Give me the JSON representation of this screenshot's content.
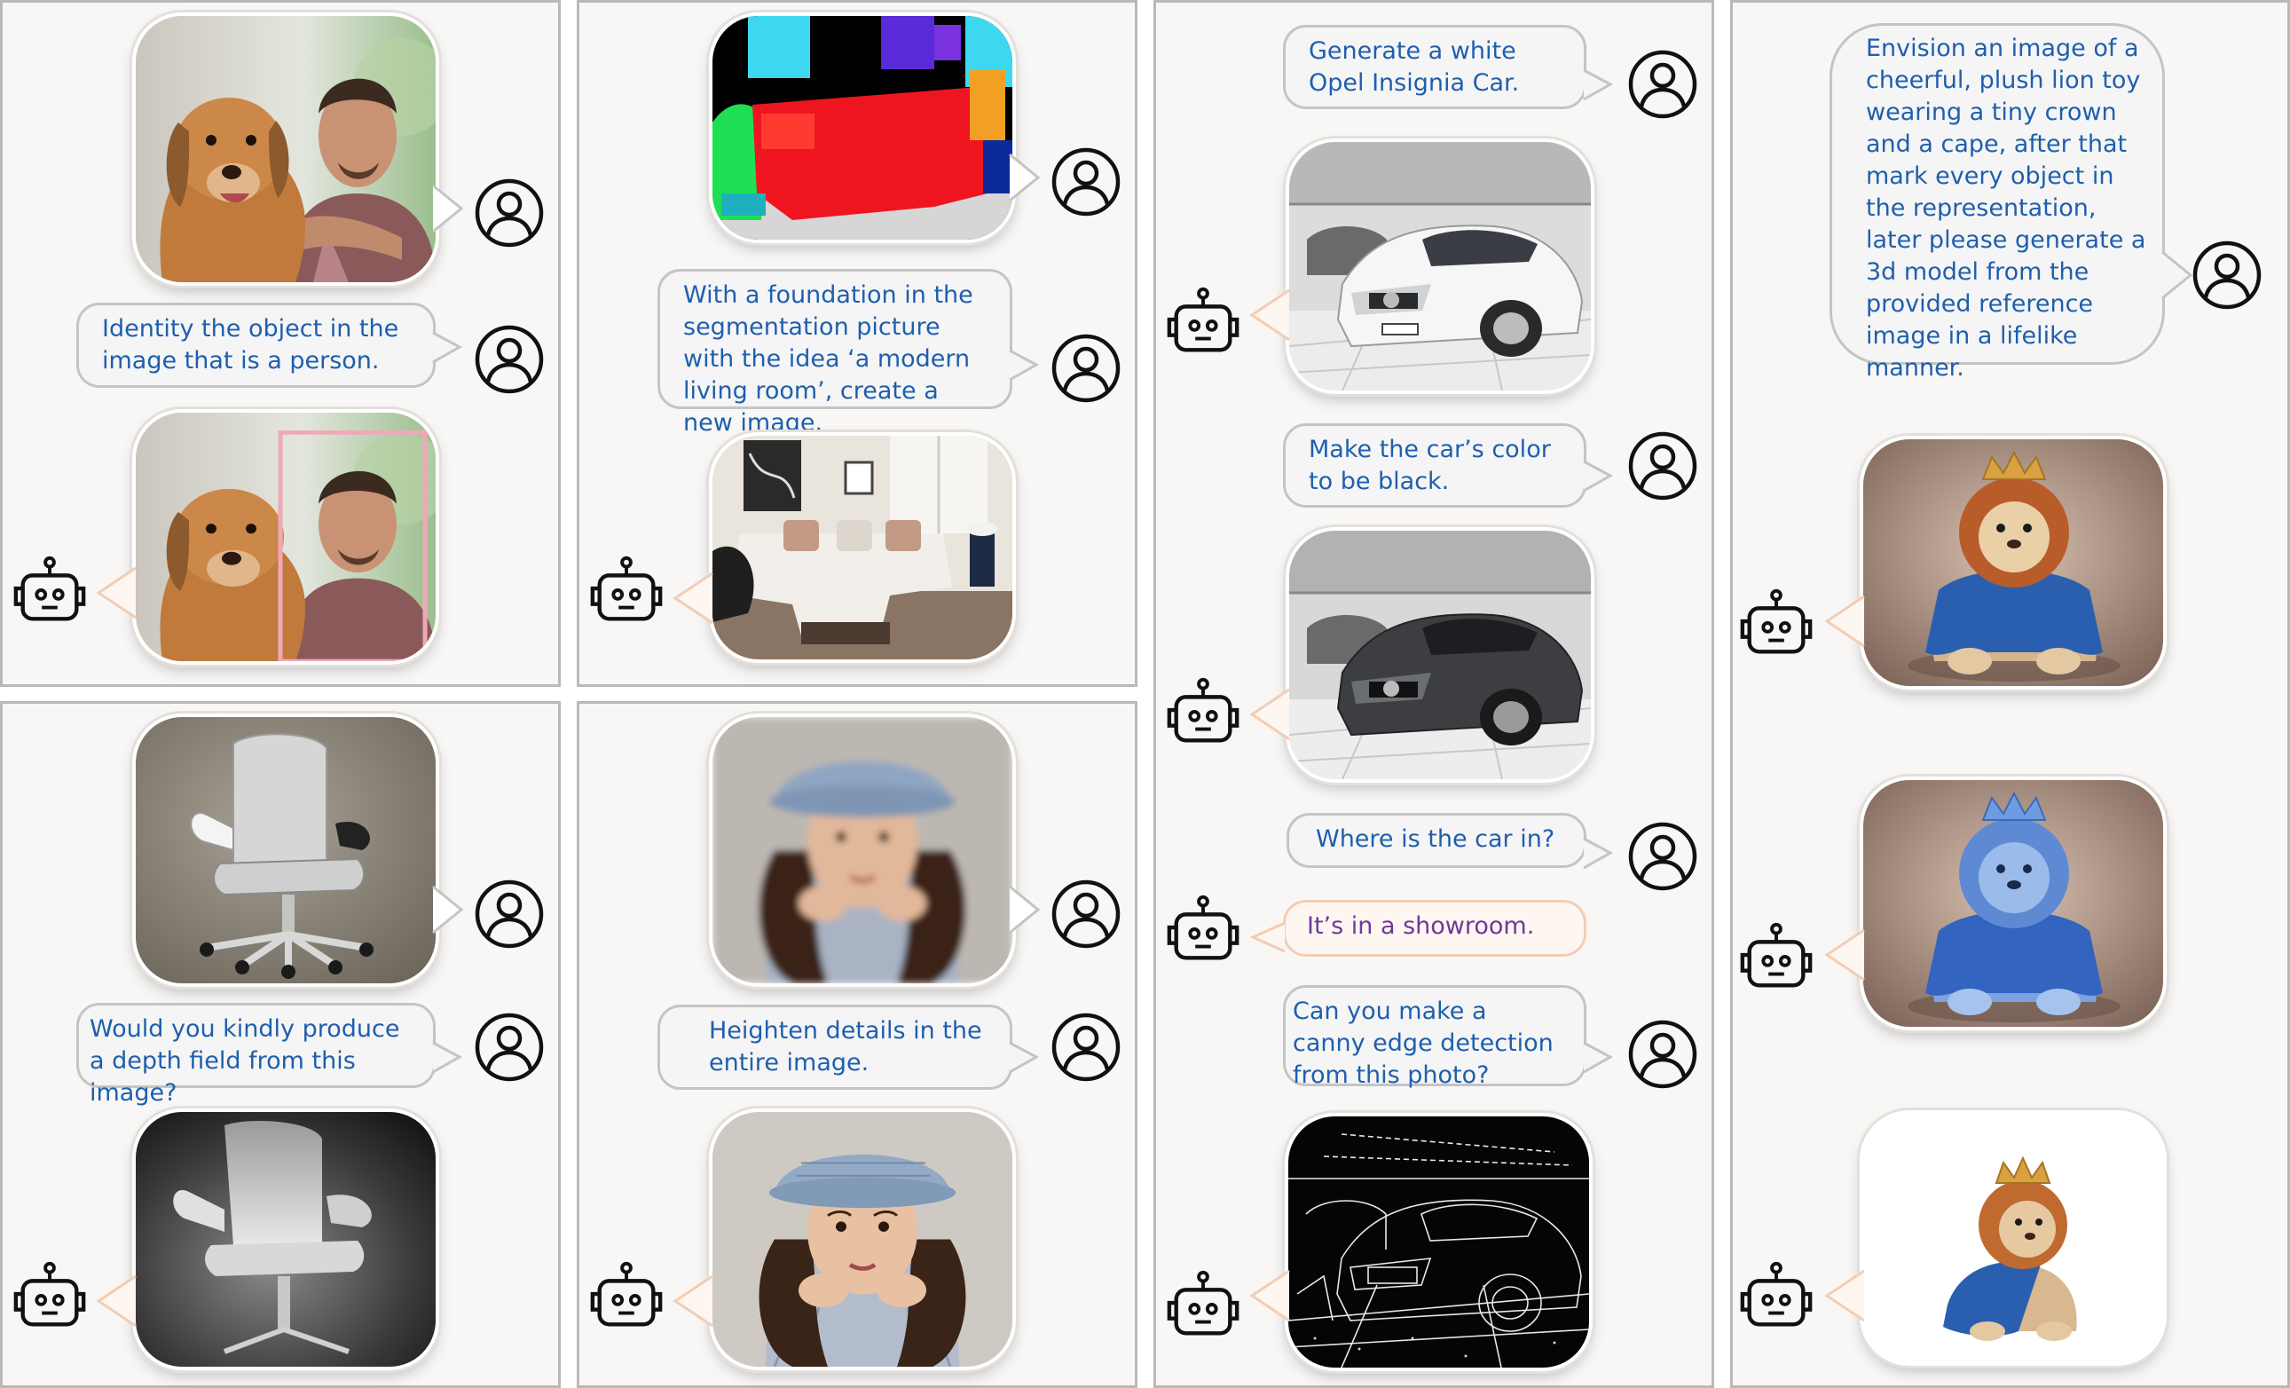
{
  "prompts": {
    "p1_user": "Identity the object in the image that is a person.",
    "p2_user": "With a foundation in the segmentation picture with the idea ‘a modern living room’, create a new image.",
    "p3_user1": "Generate a white Opel Insignia Car.",
    "p3_user2": "Make the car’s color to be black.",
    "p3_user3": "Where is the car in?",
    "p3_bot": "It’s in a showroom.",
    "p3_user4": "Can you make a canny edge detection from this photo?",
    "p4_user": "Envision an image of a cheerful, plush lion toy wearing a tiny crown and a cape, after that mark every object in the representation, later please generate a 3d model from the provided reference image in a lifelike manner.",
    "p5_user": "Would you kindly produce a depth field from this image?",
    "p6_user": "Heighten details in the entire image."
  },
  "images": {
    "p1_input": "dog and man photo",
    "p1_output": "dog and man photo with person bounding box",
    "p2_input": "segmentation map",
    "p2_output": "modern living room",
    "p3_gen1": "white Opel Insignia in showroom",
    "p3_gen2": "black Opel Insignia in showroom",
    "p3_edges": "canny edge map of car",
    "p4_gen": "plush lion toy with crown and cape",
    "p4_seg": "segmented lion toy",
    "p4_3d": "3d model of lion toy",
    "p5_input": "office chair",
    "p5_output": "depth map of chair",
    "p6_input": "blurry portrait of woman in hat",
    "p6_output": "sharp portrait of woman in hat"
  },
  "colors": {
    "user_text": "#1e5fae",
    "bot_text": "#6c3a9a",
    "bot_bubble_border": "#f2cdb4",
    "user_bubble_border": "#c4c4c4",
    "panel_border": "#b9b9b9"
  },
  "icons": {
    "user": "user-avatar-icon",
    "bot": "robot-icon"
  }
}
